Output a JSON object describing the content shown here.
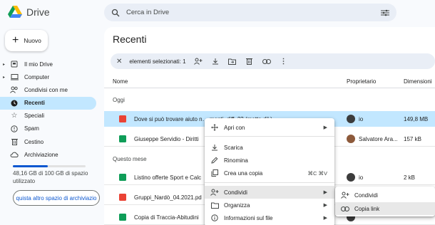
{
  "app": {
    "title": "Drive"
  },
  "search": {
    "placeholder": "Cerca in Drive"
  },
  "sidebar": {
    "new_label": "Nuovo",
    "items": [
      {
        "label": "Il mio Drive",
        "icon": "drive-icon",
        "caret": true
      },
      {
        "label": "Computer",
        "icon": "computer-icon",
        "caret": true
      },
      {
        "label": "Condivisi con me",
        "icon": "shared-icon"
      },
      {
        "label": "Recenti",
        "icon": "clock-icon",
        "active": true
      },
      {
        "label": "Speciali",
        "icon": "star-icon"
      },
      {
        "label": "Spam",
        "icon": "spam-icon"
      },
      {
        "label": "Cestino",
        "icon": "trash-icon"
      },
      {
        "label": "Archiviazione",
        "icon": "cloud-icon"
      }
    ],
    "storage_text": "48,16 GB di 100 GB di spazio utilizzato",
    "storage_fraction": 0.48,
    "storage_button": "quista altro spazio di archiviazio"
  },
  "main": {
    "title": "Recenti",
    "selection": {
      "label": "elementi selezionati: 1"
    },
    "columns": {
      "name": "Nome",
      "owner": "Proprietario",
      "size": "Dimensioni"
    },
    "sections": {
      "today": "Oggi",
      "month": "Questo mese"
    },
    "rows": [
      {
        "name": "Dove si può trovare aiuto n… menti_diff_23 (metta dil.)",
        "owner": "io",
        "size": "149,8 MB",
        "type": "video",
        "selected": true
      },
      {
        "name": "Giuseppe Servidio - Diritti",
        "owner": "Salvatore Ara...",
        "size": "157 kB",
        "type": "sheet"
      },
      {
        "name": "Listino offerte Sport e Calc",
        "owner": "io",
        "size": "2 kB",
        "type": "sheet"
      },
      {
        "name": "Gruppi_Nardò_04.2021.pd",
        "owner": "",
        "size": "",
        "type": "pdf"
      },
      {
        "name": "Copia di Traccia-Abitudini",
        "owner": "",
        "size": "",
        "type": "sheet"
      }
    ]
  },
  "context_menu": {
    "items": [
      {
        "label": "Apri con",
        "arrow": true,
        "icon": "move-icon"
      },
      {
        "label": "Scarica",
        "icon": "download-icon"
      },
      {
        "label": "Rinomina",
        "icon": "edit-icon"
      },
      {
        "label": "Crea una copia",
        "icon": "copy-icon",
        "shortcut": "⌘C ⌘V"
      },
      {
        "label": "Condividi",
        "arrow": true,
        "icon": "share-icon",
        "highlighted": true
      },
      {
        "label": "Organizza",
        "arrow": true,
        "icon": "folder-icon"
      },
      {
        "label": "Informazioni sul file",
        "arrow": true,
        "icon": "info-icon"
      }
    ]
  },
  "submenu": {
    "items": [
      {
        "label": "Condividi",
        "icon": "person-add-icon"
      },
      {
        "label": "Copia link",
        "icon": "link-icon",
        "highlighted": true
      }
    ]
  },
  "colors": {
    "accent": "#0b57d0",
    "selected_row": "#c2e7ff",
    "active_nav": "#c2e7ff",
    "sheet": "#0f9d58",
    "video": "#ea4335",
    "pdf": "#ea4335"
  }
}
